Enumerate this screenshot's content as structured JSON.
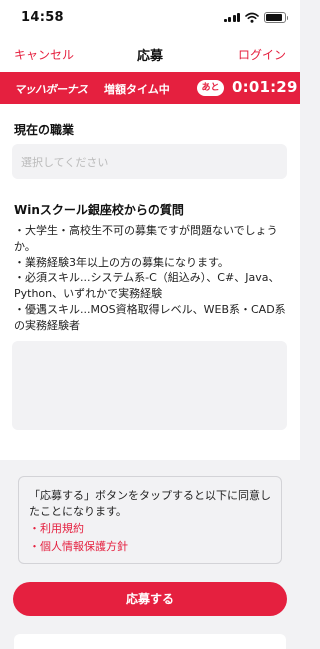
{
  "status_bar": {
    "time": "14:58",
    "battery_level": 0.9
  },
  "nav": {
    "cancel_label": "キャンセル",
    "title": "応募",
    "login_label": "ログイン"
  },
  "banner": {
    "logo_text": "マッハボーナス",
    "subtitle": "増額タイム中",
    "badge": "あと",
    "timer": "0:01:29"
  },
  "form": {
    "occupation_label": "現在の職業",
    "occupation_placeholder": "選択してください",
    "question_label": "Winスクール銀座校からの質問",
    "question_text": "・大学生・高校生不可の募集ですが問題ないでしょうか。\n・業務経験3年以上の方の募集になります。\n・必須スキル...システム系-C（組込み）、C#、Java、Python、いずれかで実務経験\n・優遇スキル...MOS資格取得レベル、WEB系・CAD系の実務経験者"
  },
  "notice": {
    "text": "「応募する」ボタンをタップすると以下に同意したことになります。",
    "links": [
      "・利用規約",
      "・個人情報保護方針"
    ]
  },
  "apply_label": "応募する",
  "colors": {
    "accent": "#e5203f",
    "field_bg": "#f2f2f4"
  }
}
